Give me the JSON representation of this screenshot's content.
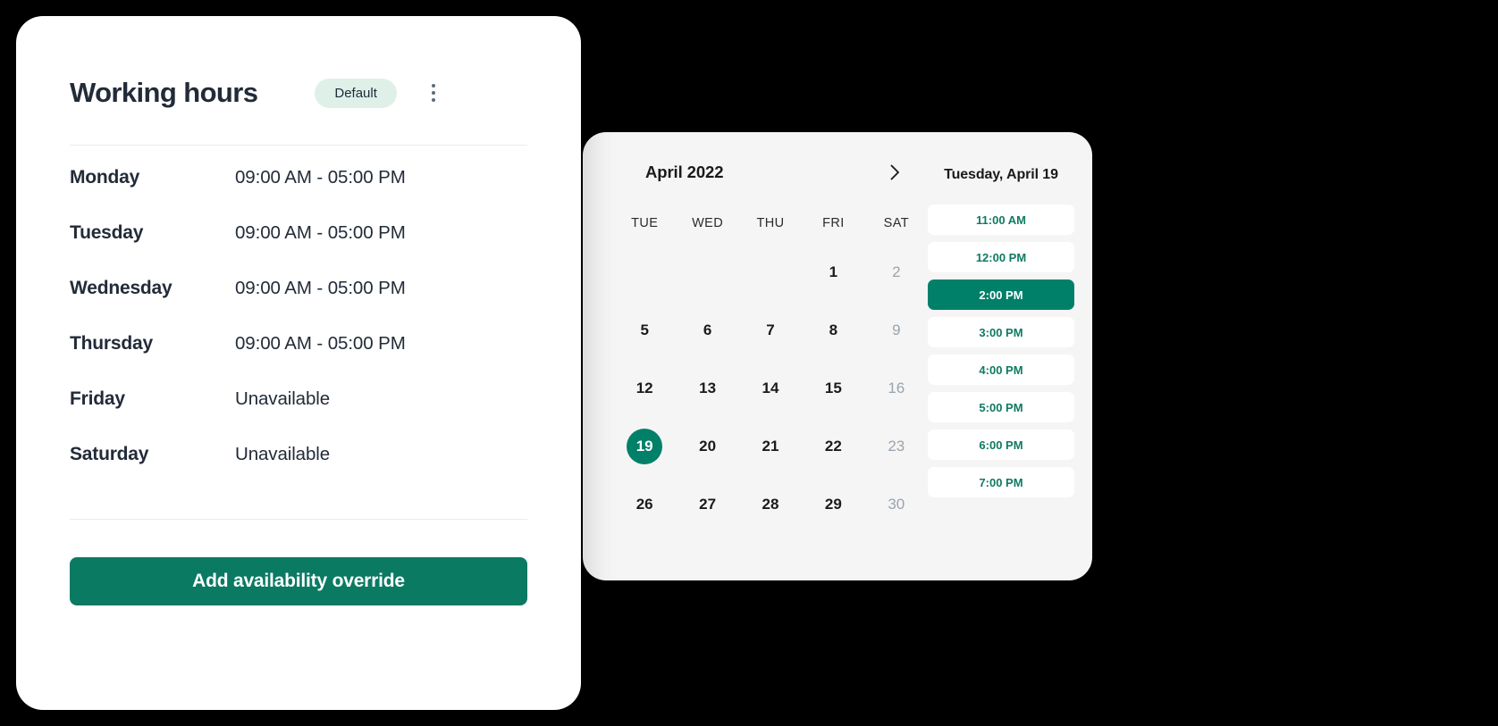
{
  "working_hours": {
    "title": "Working hours",
    "badge_label": "Default",
    "menu_icon": "kebab-menu-icon",
    "rows": [
      {
        "day": "Monday",
        "time": "09:00 AM - 05:00 PM"
      },
      {
        "day": "Tuesday",
        "time": "09:00 AM - 05:00 PM"
      },
      {
        "day": "Wednesday",
        "time": "09:00 AM - 05:00 PM"
      },
      {
        "day": "Thursday",
        "time": "09:00 AM - 05:00 PM"
      },
      {
        "day": "Friday",
        "time": "Unavailable"
      },
      {
        "day": "Saturday",
        "time": "Unavailable"
      }
    ],
    "add_override_label": "Add availability override"
  },
  "booking": {
    "calendar": {
      "month_label": "April 2022",
      "next_icon": "chevron-right-icon",
      "weekday_headers": [
        "TUE",
        "WED",
        "THU",
        "FRI",
        "SAT"
      ],
      "weeks": [
        [
          {
            "label": "",
            "state": "empty"
          },
          {
            "label": "",
            "state": "empty"
          },
          {
            "label": "",
            "state": "empty"
          },
          {
            "label": "1",
            "state": "available"
          },
          {
            "label": "2",
            "state": "disabled"
          }
        ],
        [
          {
            "label": "5",
            "state": "available"
          },
          {
            "label": "6",
            "state": "available"
          },
          {
            "label": "7",
            "state": "available"
          },
          {
            "label": "8",
            "state": "available"
          },
          {
            "label": "9",
            "state": "disabled"
          }
        ],
        [
          {
            "label": "12",
            "state": "available"
          },
          {
            "label": "13",
            "state": "available"
          },
          {
            "label": "14",
            "state": "available"
          },
          {
            "label": "15",
            "state": "available"
          },
          {
            "label": "16",
            "state": "disabled"
          }
        ],
        [
          {
            "label": "19",
            "state": "selected"
          },
          {
            "label": "20",
            "state": "available"
          },
          {
            "label": "21",
            "state": "available"
          },
          {
            "label": "22",
            "state": "available"
          },
          {
            "label": "23",
            "state": "disabled"
          }
        ],
        [
          {
            "label": "26",
            "state": "available"
          },
          {
            "label": "27",
            "state": "available"
          },
          {
            "label": "28",
            "state": "available"
          },
          {
            "label": "29",
            "state": "available"
          },
          {
            "label": "30",
            "state": "disabled"
          }
        ]
      ]
    },
    "slots_panel": {
      "selected_date_label": "Tuesday, April 19",
      "slots": [
        {
          "label": "11:00 AM",
          "state": "available"
        },
        {
          "label": "12:00 PM",
          "state": "available"
        },
        {
          "label": "2:00 PM",
          "state": "selected"
        },
        {
          "label": "3:00 PM",
          "state": "available"
        },
        {
          "label": "4:00 PM",
          "state": "available"
        },
        {
          "label": "5:00 PM",
          "state": "available"
        },
        {
          "label": "6:00 PM",
          "state": "available"
        },
        {
          "label": "7:00 PM",
          "state": "available"
        }
      ]
    }
  },
  "colors": {
    "accent_green": "#008069",
    "button_green": "#0a7a62",
    "badge_bg": "#dff0e9",
    "slot_text_green": "#0f7a63",
    "panel_bg": "#f5f5f5",
    "text_dark": "#222b38",
    "text_muted": "#9aa4ae",
    "page_bg": "#000000"
  }
}
